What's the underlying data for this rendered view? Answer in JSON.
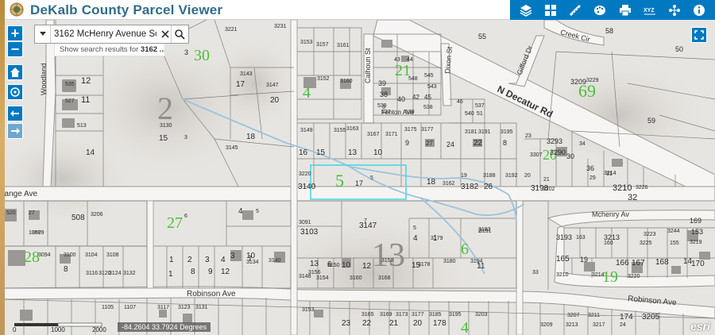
{
  "header": {
    "title": "DeKalb County Parcel Viewer",
    "accent_color": "#0079c1",
    "tools": [
      {
        "name": "layers-icon"
      },
      {
        "name": "basemap-grid-icon"
      },
      {
        "name": "measure-ruler-icon"
      },
      {
        "name": "palette-icon"
      },
      {
        "name": "print-icon"
      },
      {
        "name": "coordinates-xyz-icon"
      },
      {
        "name": "share-network-icon"
      },
      {
        "name": "info-icon"
      }
    ]
  },
  "search": {
    "value": "3162 McHenry Avenue Scc",
    "suggestion_prefix": "Show search results for",
    "suggestion_value": "3162 ..."
  },
  "status": {
    "coordinates": "-84.2604 33.7924 Degrees",
    "scale_labels": [
      "0",
      "1000",
      "2000"
    ],
    "attribution": "esri"
  },
  "map": {
    "selected_parcel_color": "#4ad8e8",
    "zone_labels": [
      "30",
      "2",
      "4",
      "21",
      "69",
      "5",
      "27",
      "28",
      "13",
      "6",
      "20",
      "19",
      "4"
    ],
    "street_labels": [
      "Woodland",
      "Calhoun St",
      "Dixon St",
      "Gifford Dr",
      "Creek Cir",
      "N Decatur Rd",
      "Fenton Ave",
      "hange Ave",
      "Robinson Ave",
      "Robinson Ave",
      "Mchenry Av"
    ],
    "parcel_labels": [
      "3221",
      "3231",
      "3",
      "3153",
      "3157",
      "3161",
      "55",
      "58",
      "50",
      "12",
      "535",
      "11",
      "527",
      "3143",
      "17",
      "3147",
      "3152",
      "3160",
      "43",
      "44",
      "39",
      "38",
      "3",
      "548",
      "545",
      "543",
      "45",
      "42",
      "539",
      "40",
      "537",
      "538",
      "539",
      "46",
      "537",
      "540",
      "51",
      "3209",
      "3229",
      "59",
      "20",
      "3",
      "513",
      "14",
      "3130",
      "15",
      "18",
      "3145",
      "3149",
      "3155",
      "3163",
      "3167",
      "3171",
      "3175",
      "3177",
      "3181",
      "3191",
      "3195",
      "16",
      "15",
      "13",
      "10",
      "9",
      "27",
      "24",
      "22",
      "8",
      "23",
      "3293",
      "34",
      "3307",
      "3290",
      "36",
      "30",
      "31",
      "3220",
      "3140",
      "17",
      "5",
      "18",
      "3162",
      "19",
      "3182",
      "3188",
      "26",
      "3192",
      "20",
      "3198",
      "21",
      "3202",
      "29",
      "3210",
      "3214",
      "32",
      "3226",
      "33",
      "3206",
      "508",
      "4",
      "5",
      "6",
      "520",
      "27",
      "3509",
      "1087",
      "7",
      "3091",
      "3103",
      "3147",
      "5",
      "4",
      "3179",
      "1",
      "3183",
      "2",
      "3191",
      "3193",
      "163",
      "3213",
      "160",
      "3225",
      "155",
      "169",
      "153",
      "3219",
      "3223",
      "3244",
      "3094",
      "3100",
      "3104",
      "3108",
      "8",
      "1",
      "2",
      "3",
      "4",
      "7",
      "10",
      "3134",
      "3",
      "3140",
      "3158",
      "3178",
      "3180",
      "3194",
      "11",
      "165",
      "166",
      "167",
      "168",
      "14",
      "170",
      "3210",
      "3214",
      "19",
      "3220",
      "3156",
      "3150",
      "3148",
      "3154",
      "3160",
      "3168",
      "3116",
      "3120",
      "3124",
      "3132",
      "1",
      "8",
      "9",
      "12",
      "13",
      "6",
      "10",
      "12",
      "15",
      "1105",
      "1107",
      "3117",
      "3123",
      "3131",
      "3153",
      "3165",
      "3169",
      "3173",
      "3177",
      "3185",
      "3195",
      "3203",
      "3209",
      "3213",
      "3217",
      "24",
      "23",
      "22",
      "21",
      "20",
      "178",
      "174",
      "3205",
      "3207",
      "3211"
    ]
  }
}
